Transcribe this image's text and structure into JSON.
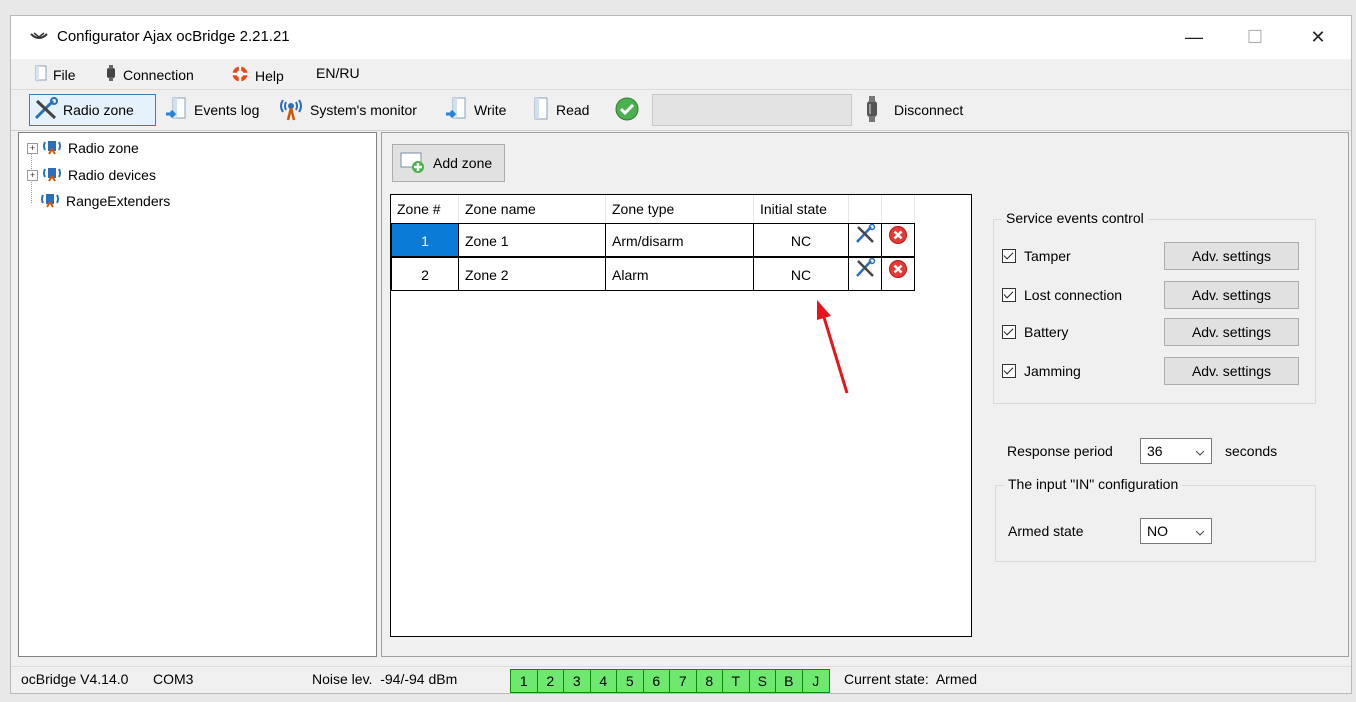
{
  "window": {
    "title": "Configurator Ajax ocBridge 2.21.21",
    "controls": {
      "minimize": "—",
      "maximize": "☐",
      "close": "✕"
    }
  },
  "menu": {
    "items": [
      {
        "label": "File",
        "icon": "file-icon"
      },
      {
        "label": "Connection",
        "icon": "connection-icon"
      },
      {
        "label": "Help",
        "icon": "help-lifebuoy-icon"
      },
      {
        "label": "EN/RU",
        "icon": ""
      }
    ]
  },
  "toolbar": {
    "radio_zone": "Radio zone",
    "events_log": "Events log",
    "systems_monitor": "System's monitor",
    "write": "Write",
    "read": "Read",
    "disconnect": "Disconnect"
  },
  "tree": {
    "items": [
      {
        "label": "Radio zone",
        "expandable": true
      },
      {
        "label": "Radio devices",
        "expandable": true
      },
      {
        "label": "RangeExtenders",
        "expandable": false
      }
    ]
  },
  "zones": {
    "add_zone_label": "Add zone",
    "columns": [
      "Zone #",
      "Zone name",
      "Zone type",
      "Initial state"
    ],
    "rows": [
      {
        "num": "1",
        "name": "Zone 1",
        "type": "Arm/disarm",
        "state": "NC",
        "selected": true
      },
      {
        "num": "2",
        "name": "Zone 2",
        "type": "Alarm",
        "state": "NC",
        "selected": false
      }
    ]
  },
  "service_events": {
    "title": "Service events control",
    "items": [
      {
        "label": "Tamper",
        "checked": true,
        "button": "Adv. settings"
      },
      {
        "label": "Lost connection",
        "checked": true,
        "button": "Adv. settings"
      },
      {
        "label": "Battery",
        "checked": true,
        "button": "Adv. settings"
      },
      {
        "label": "Jamming",
        "checked": true,
        "button": "Adv. settings"
      }
    ]
  },
  "response": {
    "label": "Response period",
    "value": "36",
    "unit": "seconds"
  },
  "input_config": {
    "title": "The input \"IN\" configuration",
    "armed_label": "Armed state",
    "armed_value": "NO"
  },
  "status": {
    "device": "ocBridge V4.14.0",
    "port": "COM3",
    "noise": "Noise lev.  -94/-94 dBm",
    "cells": [
      "1",
      "2",
      "3",
      "4",
      "5",
      "6",
      "7",
      "8",
      "T",
      "S",
      "B",
      "J"
    ],
    "current_state": "Current state:  Armed"
  },
  "colors": {
    "selection": "#0a7bd6",
    "status_green": "#6fe86f",
    "annotation_arrow": "#e8131b"
  }
}
